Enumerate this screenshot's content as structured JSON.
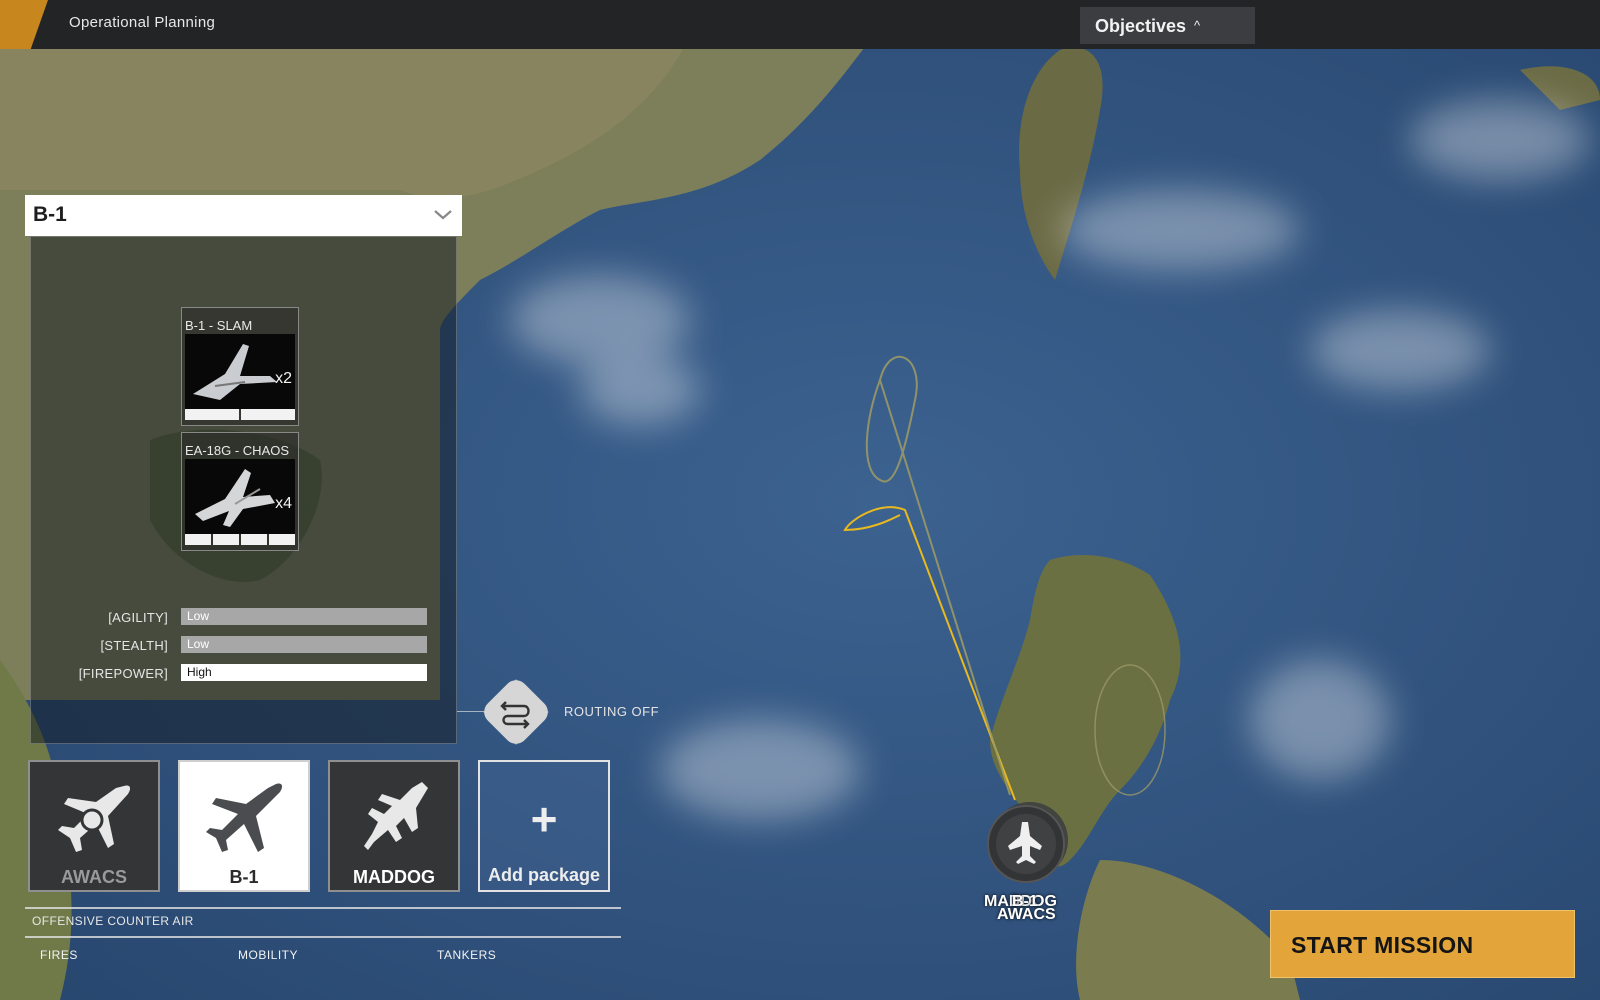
{
  "header": {
    "title": "Operational Planning",
    "objectives_label": "Objectives",
    "objectives_icon": "chevron-up-icon"
  },
  "panel": {
    "title": "B-1",
    "units": [
      {
        "name": "B-1 - SLAM",
        "count": "x2",
        "slots": 2
      },
      {
        "name": "EA-18G - CHAOS",
        "count": "x4",
        "slots": 4
      }
    ],
    "stats": [
      {
        "label": "[AGILITY]",
        "value": "Low"
      },
      {
        "label": "[STEALTH]",
        "value": "Low"
      },
      {
        "label": "[FIREPOWER]",
        "value": "High"
      }
    ]
  },
  "routing": {
    "label": "ROUTING OFF",
    "icon": "route-icon"
  },
  "packages": [
    {
      "label": "AWACS",
      "icon": "awacs-plane-icon"
    },
    {
      "label": "B-1",
      "icon": "bomber-plane-icon"
    },
    {
      "label": "MADDOG",
      "icon": "fighter-jet-icon"
    }
  ],
  "add_package": {
    "label": "Add package",
    "icon": "plus-icon"
  },
  "category": "OFFENSIVE COUNTER AIR",
  "tabs": [
    "FIRES",
    "MOBILITY",
    "TANKERS"
  ],
  "map_marker": {
    "label_top_a": "MADDOG",
    "label_top_b": "B-1",
    "label_bottom": "AWACS"
  },
  "start_mission": "START MISSION",
  "colors": {
    "accent": "#c8861e",
    "start_button": "#e3a43a",
    "route_line": "#e9b91e"
  }
}
